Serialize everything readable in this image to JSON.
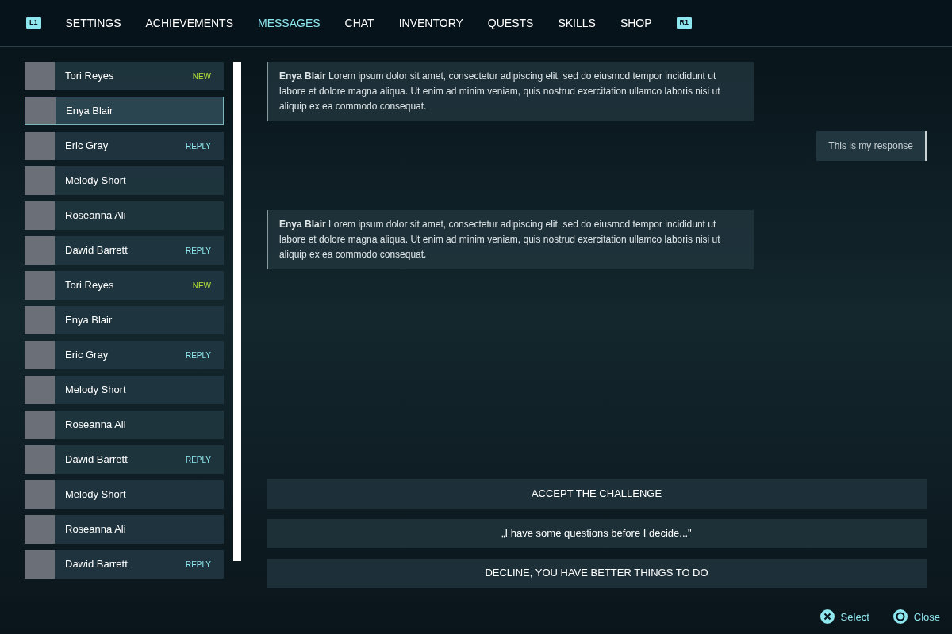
{
  "prev_tab_hint": "L1",
  "tabs": [
    {
      "label": "SETTINGS",
      "selected": false
    },
    {
      "label": "ACHIEVEMENTS",
      "selected": false
    },
    {
      "label": "MESSAGES",
      "selected": true
    },
    {
      "label": "CHAT",
      "selected": false
    },
    {
      "label": "INVENTORY",
      "selected": false
    },
    {
      "label": "QUESTS",
      "selected": false
    },
    {
      "label": "SKILLS",
      "selected": false
    },
    {
      "label": "SHOP",
      "selected": false
    }
  ],
  "next_tab_hint": "R1",
  "contacts": [
    {
      "name": "Tori Reyes",
      "badge": "NEW",
      "kind": "new",
      "selected": false
    },
    {
      "name": "Enya Blair",
      "selected": true
    },
    {
      "name": "Eric Gray",
      "badge": "REPLY",
      "kind": "reply",
      "selected": false
    },
    {
      "name": "Melody Short",
      "selected": false
    },
    {
      "name": "Roseanna Ali",
      "selected": false
    },
    {
      "name": "Dawid Barrett",
      "badge": "REPLY",
      "kind": "reply",
      "selected": false
    },
    {
      "name": "Tori Reyes",
      "badge": "NEW",
      "kind": "new",
      "selected": false
    },
    {
      "name": "Enya Blair",
      "selected": false
    },
    {
      "name": "Eric Gray",
      "badge": "REPLY",
      "kind": "reply",
      "selected": false
    },
    {
      "name": "Melody Short",
      "selected": false
    },
    {
      "name": "Roseanna Ali",
      "selected": false
    },
    {
      "name": "Dawid Barrett",
      "badge": "REPLY",
      "kind": "reply",
      "selected": false
    },
    {
      "name": "Melody Short",
      "selected": false
    },
    {
      "name": "Roseanna Ali",
      "selected": false
    },
    {
      "name": "Dawid Barrett",
      "badge": "REPLY",
      "kind": "reply",
      "selected": false
    }
  ],
  "messages": [
    {
      "kind": "incoming",
      "text": "**Enya Blair** Lorem ipsum dolor sit amet,  consectetur adipiscing elit, sed do eiusmod tempor incididunt ut labore et dolore magna aliqua. Ut enim ad minim veniam, quis nostrud exercitation ullamco laboris nisi ut aliquip ex ea commodo consequat."
    },
    {
      "kind": "outgoing",
      "text": "This is my response"
    },
    {
      "kind": "incoming",
      "text": "**Enya Blair** Lorem ipsum dolor sit amet,  consectetur adipiscing elit, sed do eiusmod tempor incididunt ut labore et dolore magna aliqua. Ut enim ad minim veniam, quis nostrud exercitation ullamco laboris nisi ut aliquip ex ea commodo consequat."
    }
  ],
  "choices": [
    "ACCEPT THE CHALLENGE",
    "„I have some questions before I decide...\"",
    "DECLINE, YOU HAVE BETTER THINGS TO DO"
  ],
  "hints": [
    {
      "kind": "cross",
      "label": "Select"
    },
    {
      "kind": "circle",
      "label": "Close"
    }
  ]
}
